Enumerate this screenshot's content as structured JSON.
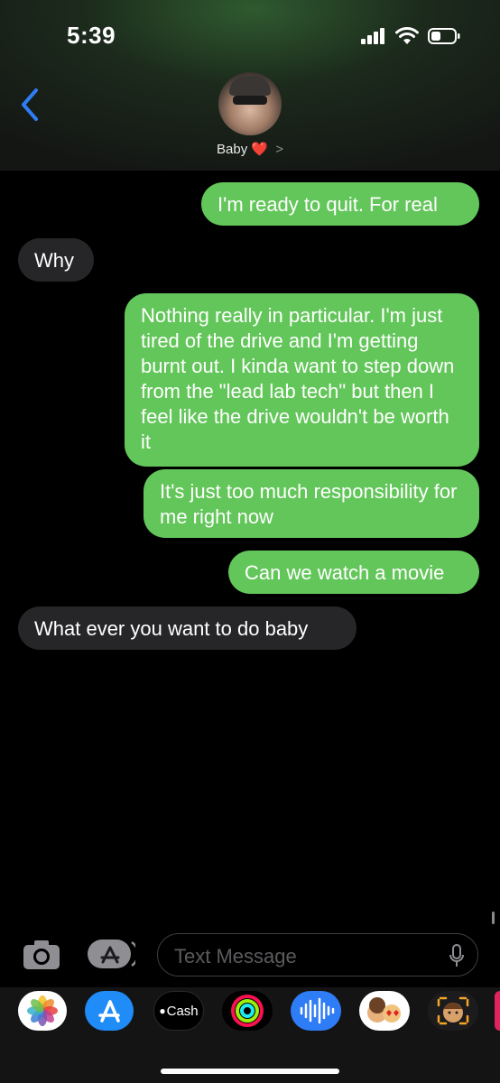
{
  "status_bar": {
    "time": "5:39"
  },
  "contact": {
    "name": "Baby",
    "heart": "❤️",
    "chevron": ">"
  },
  "messages": [
    {
      "type": "sent",
      "text": "I'm ready to quit. For real"
    },
    {
      "type": "received",
      "text": "Why"
    },
    {
      "type": "sent",
      "text": "Nothing really in particular. I'm just tired of the drive and I'm getting burnt out. I kinda want to step down from the \"lead lab tech\" but then I feel like the drive wouldn't be worth it"
    },
    {
      "type": "sent",
      "text": "It's just too much responsibility for me right now"
    },
    {
      "type": "sent",
      "text": "Can we watch a movie"
    },
    {
      "type": "received",
      "text": "What ever you want to do baby"
    }
  ],
  "input": {
    "placeholder": "Text Message"
  },
  "app_drawer": {
    "apps": [
      {
        "name": "photos-icon"
      },
      {
        "name": "app-store-icon"
      },
      {
        "name": "apple-cash-icon",
        "label": "Cash"
      },
      {
        "name": "activity-icon"
      },
      {
        "name": "audio-message-icon"
      },
      {
        "name": "memoji-stickers-icon"
      },
      {
        "name": "animoji-icon"
      }
    ]
  },
  "colors": {
    "sent_bubble": "#63c65a",
    "received_bubble": "#262629",
    "back_chevron": "#2e7cf6"
  }
}
